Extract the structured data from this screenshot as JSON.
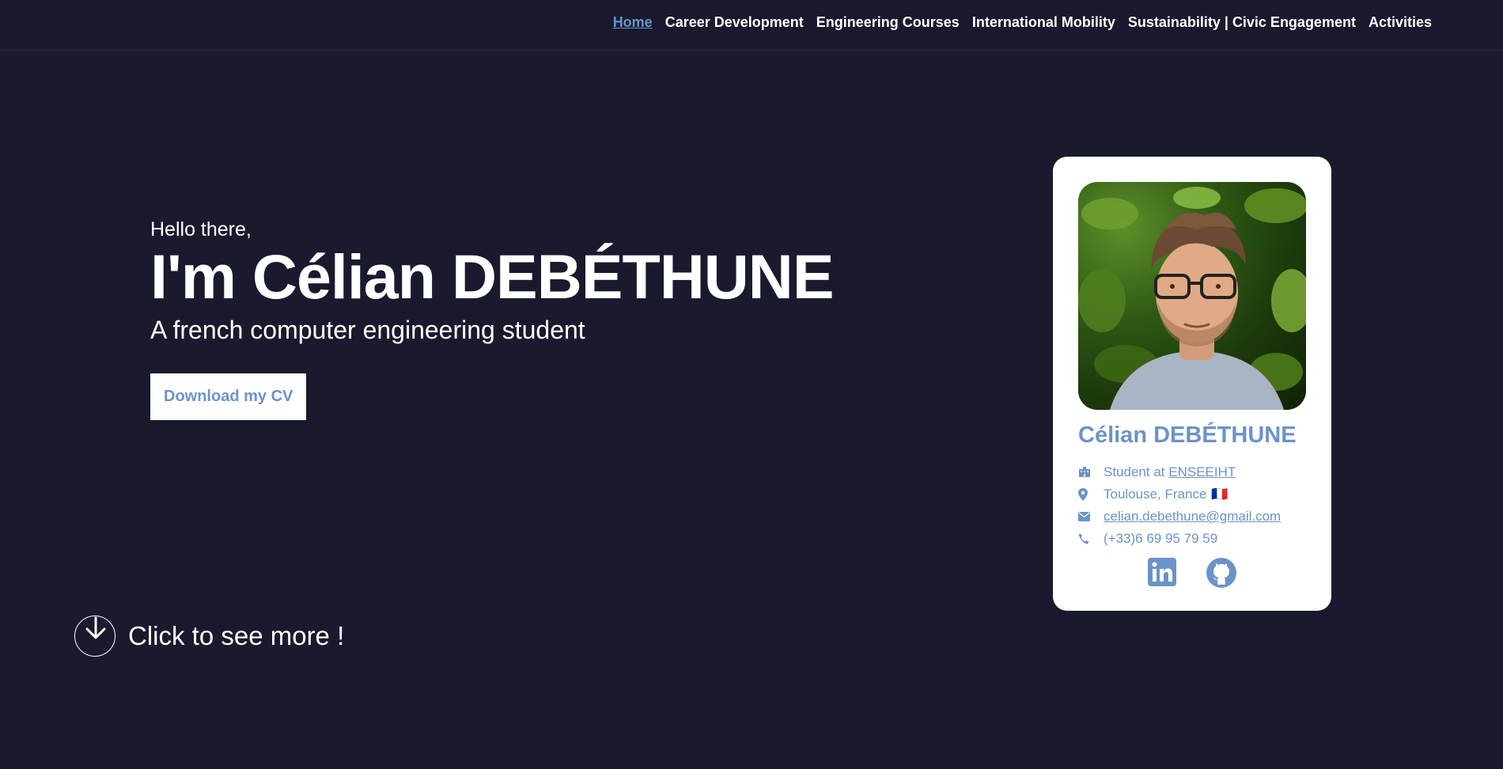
{
  "nav": {
    "items": [
      {
        "label": "Home",
        "active": true
      },
      {
        "label": "Career Development",
        "active": false
      },
      {
        "label": "Engineering Courses",
        "active": false
      },
      {
        "label": "International Mobility",
        "active": false
      },
      {
        "label": "Sustainability | Civic Engagement",
        "active": false
      },
      {
        "label": "Activities",
        "active": false
      }
    ]
  },
  "hero": {
    "greeting": "Hello there,",
    "headline": "I'm Célian DEBÉTHUNE",
    "subtitle": "A french computer engineering student",
    "cv_button": "Download my CV"
  },
  "see_more": {
    "label": "Click to see more !",
    "icon": "arrow-down-circle-icon"
  },
  "card": {
    "name": "Célian DEBÉTHUNE",
    "school_prefix": "Student at ",
    "school_link": "ENSEEIHT",
    "location": "Toulouse, France",
    "location_flag": "🇫🇷",
    "email": "celian.debethune@gmail.com",
    "phone": "(+33)6 69 95 79 59",
    "socials": [
      "linkedin-icon",
      "github-icon"
    ]
  },
  "colors": {
    "background": "#1a1a2e",
    "accent": "#6b93c8",
    "text": "#ffffff",
    "card": "#ffffff"
  }
}
